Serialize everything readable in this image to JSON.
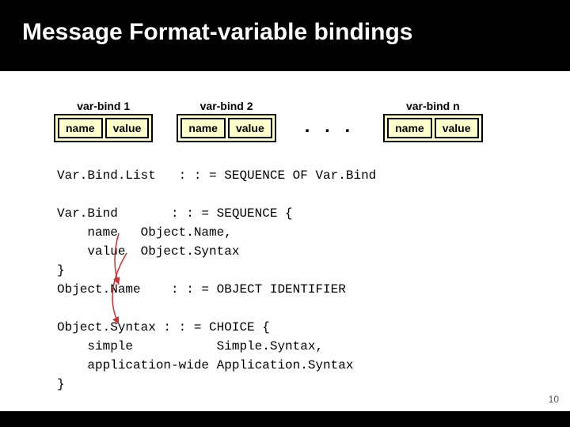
{
  "title": "Message Format-variable bindings",
  "varbinds": [
    {
      "label": "var-bind 1",
      "name": "name",
      "value": "value"
    },
    {
      "label": "var-bind 2",
      "name": "name",
      "value": "value"
    },
    {
      "label": "var-bind n",
      "name": "name",
      "value": "value"
    }
  ],
  "ellipsis": ". . .",
  "code": {
    "l1": "Var.Bind.List   : : = SEQUENCE OF Var.Bind",
    "l2": "",
    "l3": "Var.Bind       : : = SEQUENCE {",
    "l4": "    name   Object.Name,",
    "l5": "    value  Object.Syntax",
    "l6": "}",
    "l7": "Object.Name    : : = OBJECT IDENTIFIER",
    "l8": "",
    "l9": "Object.Syntax : : = CHOICE {",
    "l10": "    simple           Simple.Syntax,",
    "l11": "    application-wide Application.Syntax",
    "l12": "}"
  },
  "page": "10"
}
